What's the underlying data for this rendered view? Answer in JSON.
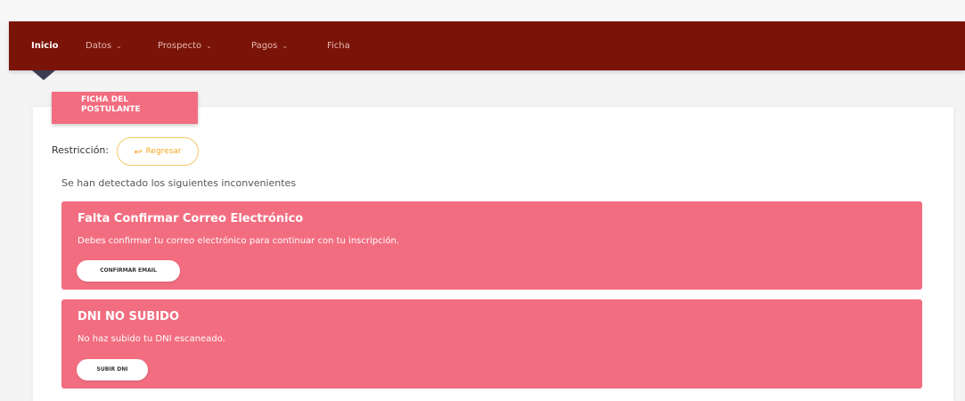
{
  "nav": {
    "items": [
      {
        "label": "Inicio",
        "active": true,
        "dropdown": false
      },
      {
        "label": "Datos",
        "active": false,
        "dropdown": true
      },
      {
        "label": "Prospecto",
        "active": false,
        "dropdown": true
      },
      {
        "label": "Pagos",
        "active": false,
        "dropdown": true
      },
      {
        "label": "Ficha",
        "active": false,
        "dropdown": false
      }
    ],
    "chevron_icon": "chevron-down-icon"
  },
  "tag": {
    "line1": "FICHA DEL",
    "line2": "POSTULANTE"
  },
  "restriction": {
    "label": "Restricción:",
    "back_button": {
      "label": "Regresar",
      "icon": "reply-arrow-icon"
    }
  },
  "notice": "Se han detectado los siguientes inconvenientes",
  "alerts": [
    {
      "title": "Falta Confirmar Correo Electrónico",
      "message": "Debes confirmar tu correo electrónico para continuar con tu inscripción.",
      "button": "CONFIRMAR EMAIL"
    },
    {
      "title": "DNI NO SUBIDO",
      "message": "No haz subido tu DNI escaneado.",
      "button": "SUBIR DNI"
    }
  ],
  "colors": {
    "navbar": "#7a1409",
    "alert": "#f26d80",
    "accent": "#f5a623"
  }
}
